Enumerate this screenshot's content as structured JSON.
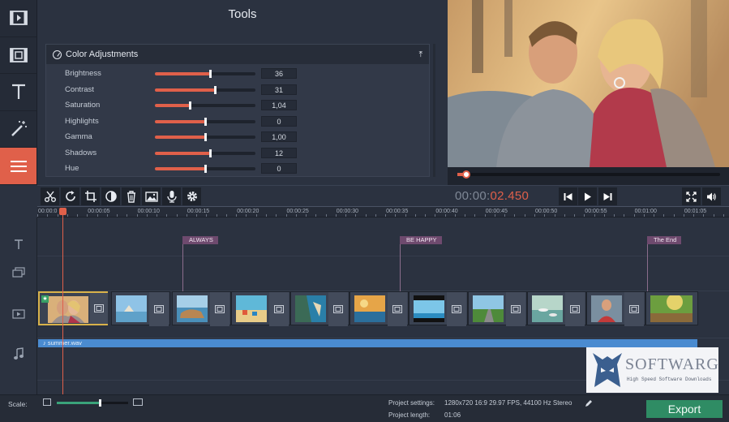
{
  "sidebar": {
    "items": [
      {
        "icon": "film-icon"
      },
      {
        "icon": "clip-icon"
      },
      {
        "icon": "text-icon"
      },
      {
        "icon": "magic-wand-icon"
      },
      {
        "icon": "menu-icon",
        "active": true
      }
    ]
  },
  "tools": {
    "title": "Tools",
    "panel_title": "Color Adjustments",
    "adjustments": [
      {
        "label": "Brightness",
        "value": "36",
        "level": 0.55
      },
      {
        "label": "Contrast",
        "value": "31",
        "level": 0.6
      },
      {
        "label": "Saturation",
        "value": "1,04",
        "level": 0.35
      },
      {
        "label": "Highlights",
        "value": "0",
        "level": 0.5
      },
      {
        "label": "Gamma",
        "value": "1,00",
        "level": 0.5
      },
      {
        "label": "Shadows",
        "value": "12",
        "level": 0.55
      },
      {
        "label": "Hue",
        "value": "0",
        "level": 0.5
      }
    ]
  },
  "player": {
    "time_elapsed": "00:00:",
    "time_frames": "02.450",
    "progress": 0.02
  },
  "timeline": {
    "ruler": [
      "00:00:0",
      "00:00:05",
      "00:00:10",
      "00:00:15",
      "00:00:20",
      "00:00:25",
      "00:00:30",
      "00:00:35",
      "00:00:40",
      "00:00:45",
      "00:00:50",
      "00:00:55",
      "00:01:00",
      "00:01:05"
    ],
    "markers": [
      "ALWAYS",
      "BE HAPPY",
      "The End"
    ],
    "audio_clip": "summer.wav"
  },
  "watermark": {
    "name": "SOFTWARG",
    "tagline": "High Speed Software Downloads"
  },
  "bottom": {
    "scale_label": "Scale:",
    "scale_level": 0.6,
    "settings_label": "Project settings:",
    "settings_value": "1280x720 16:9 29.97 FPS, 44100 Hz Stereo",
    "length_label": "Project length:",
    "length_value": "01:06",
    "export_label": "Export"
  },
  "colors": {
    "accent": "#e0604a",
    "export": "#2f8c64",
    "audio": "#4a8bd0",
    "marker": "#6e4a6e"
  }
}
